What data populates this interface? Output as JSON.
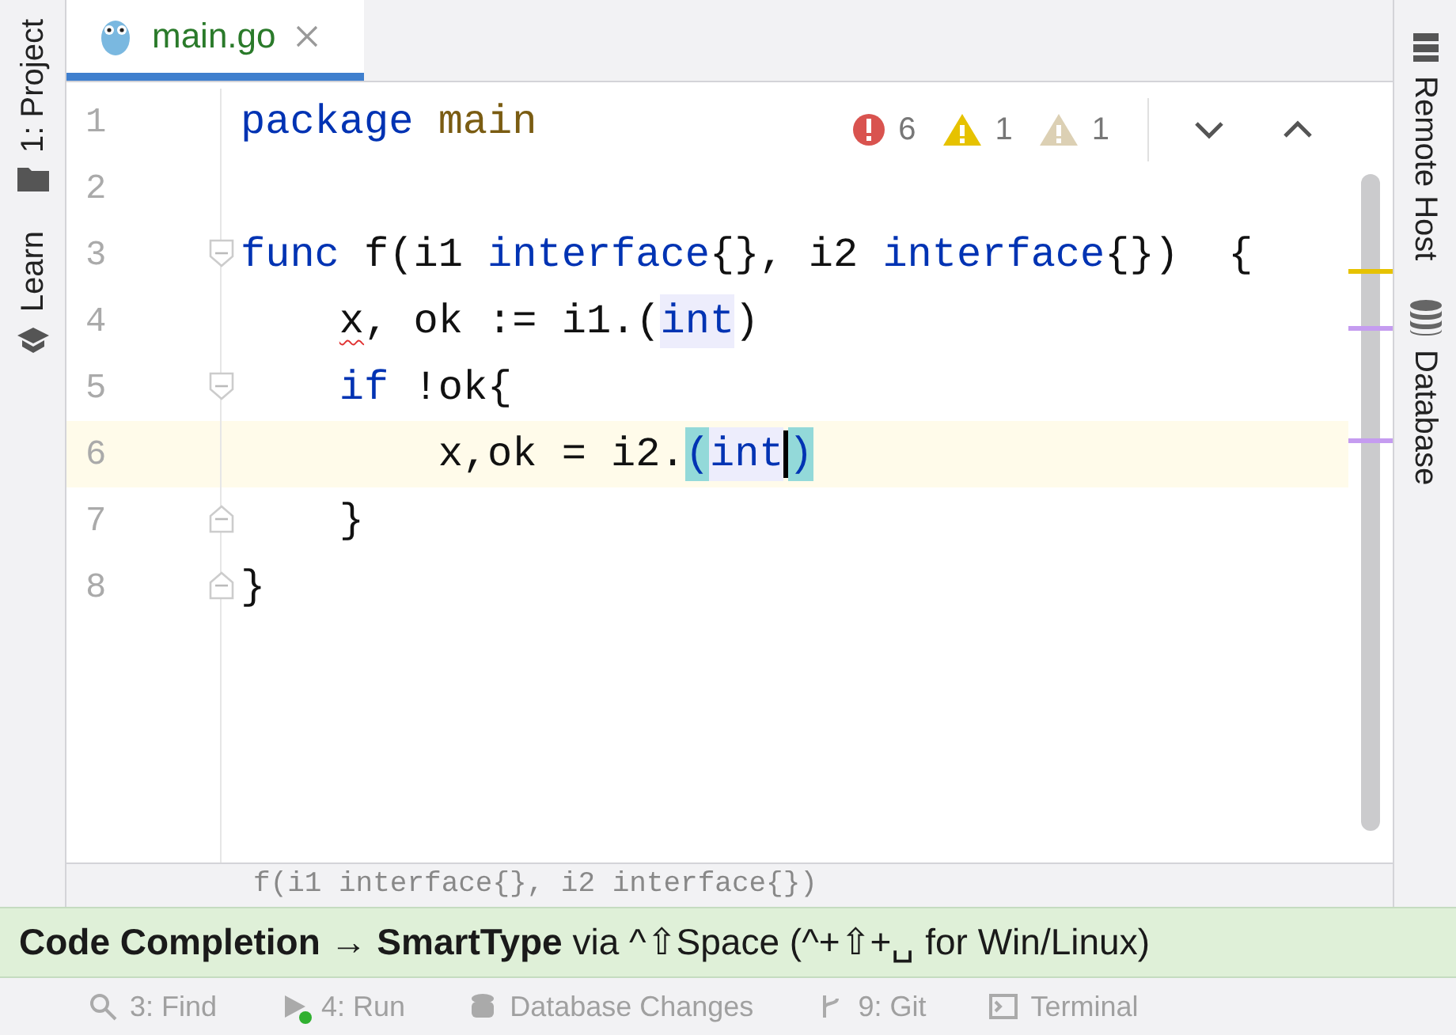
{
  "left_tool_windows": [
    {
      "label": "1: Project",
      "kind": "folder"
    },
    {
      "label": "Learn",
      "kind": "cap"
    }
  ],
  "tab": {
    "title": "main.go",
    "selected": true
  },
  "inspections": [
    {
      "kind": "error",
      "count": "6"
    },
    {
      "kind": "warning",
      "count": "1"
    },
    {
      "kind": "weak",
      "count": "1"
    }
  ],
  "lines": [
    {
      "number": "1",
      "current": false,
      "fold_start": false,
      "fold_end": false,
      "tokens": [
        {
          "text": "package",
          "kind": "keyword"
        },
        {
          "text": " main",
          "kind": "package"
        }
      ]
    },
    {
      "number": "2",
      "current": false,
      "fold_start": false,
      "fold_end": false
    },
    {
      "number": "3",
      "current": false,
      "fold_start": true,
      "fold_end": false,
      "tokens": [
        {
          "text": "func",
          "kind": "keyword"
        },
        {
          "text": " f(i1 ",
          "kind": "plain"
        },
        {
          "text": "interface",
          "kind": "keyword"
        },
        {
          "text": "{}, i2 ",
          "kind": "plain"
        },
        {
          "text": "interface",
          "kind": "keyword"
        },
        {
          "text": "{})  {",
          "kind": "plain"
        }
      ]
    },
    {
      "number": "4",
      "current": false,
      "fold_start": false,
      "fold_end": false,
      "tokens": [
        {
          "text": "    x",
          "kind": "error"
        },
        {
          "text": ", ok := i1.(",
          "kind": "plain"
        },
        {
          "text": "int",
          "kind": "typeref"
        },
        {
          "text": ")",
          "kind": "plain"
        }
      ]
    },
    {
      "number": "5",
      "current": false,
      "fold_start": true,
      "fold_end": false,
      "tokens": [
        {
          "text": "    if",
          "kind": "keyword"
        },
        {
          "text": " !ok{",
          "kind": "plain"
        }
      ]
    },
    {
      "number": "6",
      "current": true,
      "fold_start": false,
      "fold_end": false,
      "tokens": [
        {
          "text": "        x,ok = i2.",
          "kind": "guide"
        },
        {
          "text": "(",
          "kind": "match"
        },
        {
          "text": "int",
          "kind": "typeref"
        },
        {
          "text": ")",
          "kind": "match",
          "caret": true
        }
      ]
    },
    {
      "number": "7",
      "current": false,
      "fold_start": false,
      "fold_end": true,
      "tokens": [
        {
          "text": "    }",
          "kind": "plain"
        }
      ]
    },
    {
      "number": "8",
      "current": false,
      "fold_start": false,
      "fold_end": true,
      "tokens": [
        {
          "text": "}",
          "kind": "plain"
        }
      ]
    }
  ],
  "scroll_marks": [
    {
      "color": "#e6c200"
    },
    {
      "color": "#c59cf0"
    },
    {
      "color": "#c59cf0"
    }
  ],
  "right_tool_windows": [
    {
      "label": "Remote Host",
      "kind": "server"
    },
    {
      "label": "Database",
      "kind": "database"
    }
  ],
  "breadcrumb": "f(i1 interface{}, i2 interface{})",
  "tip": "**Code Completion → SmartType** via ^⇧Space (^+⇧+␣ for Win/Linux)",
  "bottom_tool_windows": [
    {
      "label": "3: Find",
      "kind": "search",
      "running": false
    },
    {
      "label": "4: Run",
      "kind": "run",
      "running": true
    },
    {
      "label": "Database Changes",
      "kind": "changes",
      "running": false
    },
    {
      "label": "9: Git",
      "kind": "git",
      "running": false
    },
    {
      "label": "Terminal",
      "kind": "terminal",
      "running": false
    }
  ]
}
